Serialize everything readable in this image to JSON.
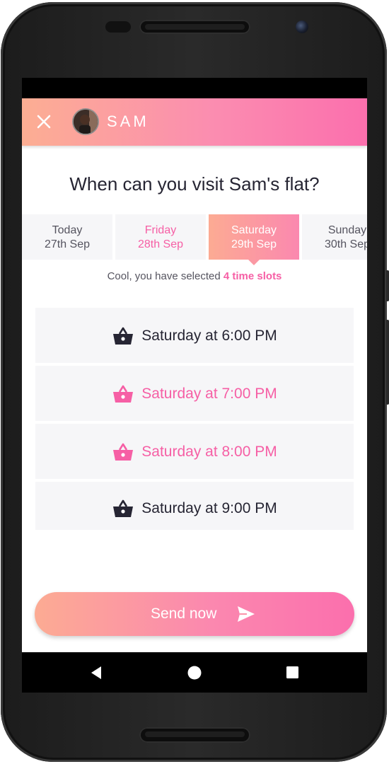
{
  "header": {
    "name": "SAM",
    "close_icon": "close-icon",
    "avatar": "avatar"
  },
  "question": "When can you visit Sam's flat?",
  "days": [
    {
      "day": "Today",
      "date": "27th Sep",
      "state": "normal"
    },
    {
      "day": "Friday",
      "date": "28th Sep",
      "state": "highlighted"
    },
    {
      "day": "Saturday",
      "date": "29th Sep",
      "state": "selected"
    },
    {
      "day": "Sunday",
      "date": "30th Sep",
      "state": "normal"
    }
  ],
  "selection_note": {
    "prefix": "Cool, you have selected ",
    "count_text": "4 time slots"
  },
  "slots": [
    {
      "label": "Saturday at 6:00 PM",
      "active": false,
      "icon": "basket-icon"
    },
    {
      "label": "Saturday at 7:00 PM",
      "active": true,
      "icon": "basket-icon"
    },
    {
      "label": "Saturday at 8:00 PM",
      "active": true,
      "icon": "basket-icon"
    },
    {
      "label": "Saturday at 9:00 PM",
      "active": false,
      "icon": "basket-icon"
    }
  ],
  "send_button": {
    "label": "Send now",
    "icon": "send-icon"
  },
  "navbar": {
    "back_icon": "back-icon",
    "home_icon": "home-icon",
    "recents_icon": "recents-icon"
  },
  "colors": {
    "accent": "#f65fa5",
    "gradient_start": "#fcab93",
    "gradient_end": "#fb6fad",
    "text_dark": "#262533",
    "tile_bg": "#f6f6f8"
  }
}
